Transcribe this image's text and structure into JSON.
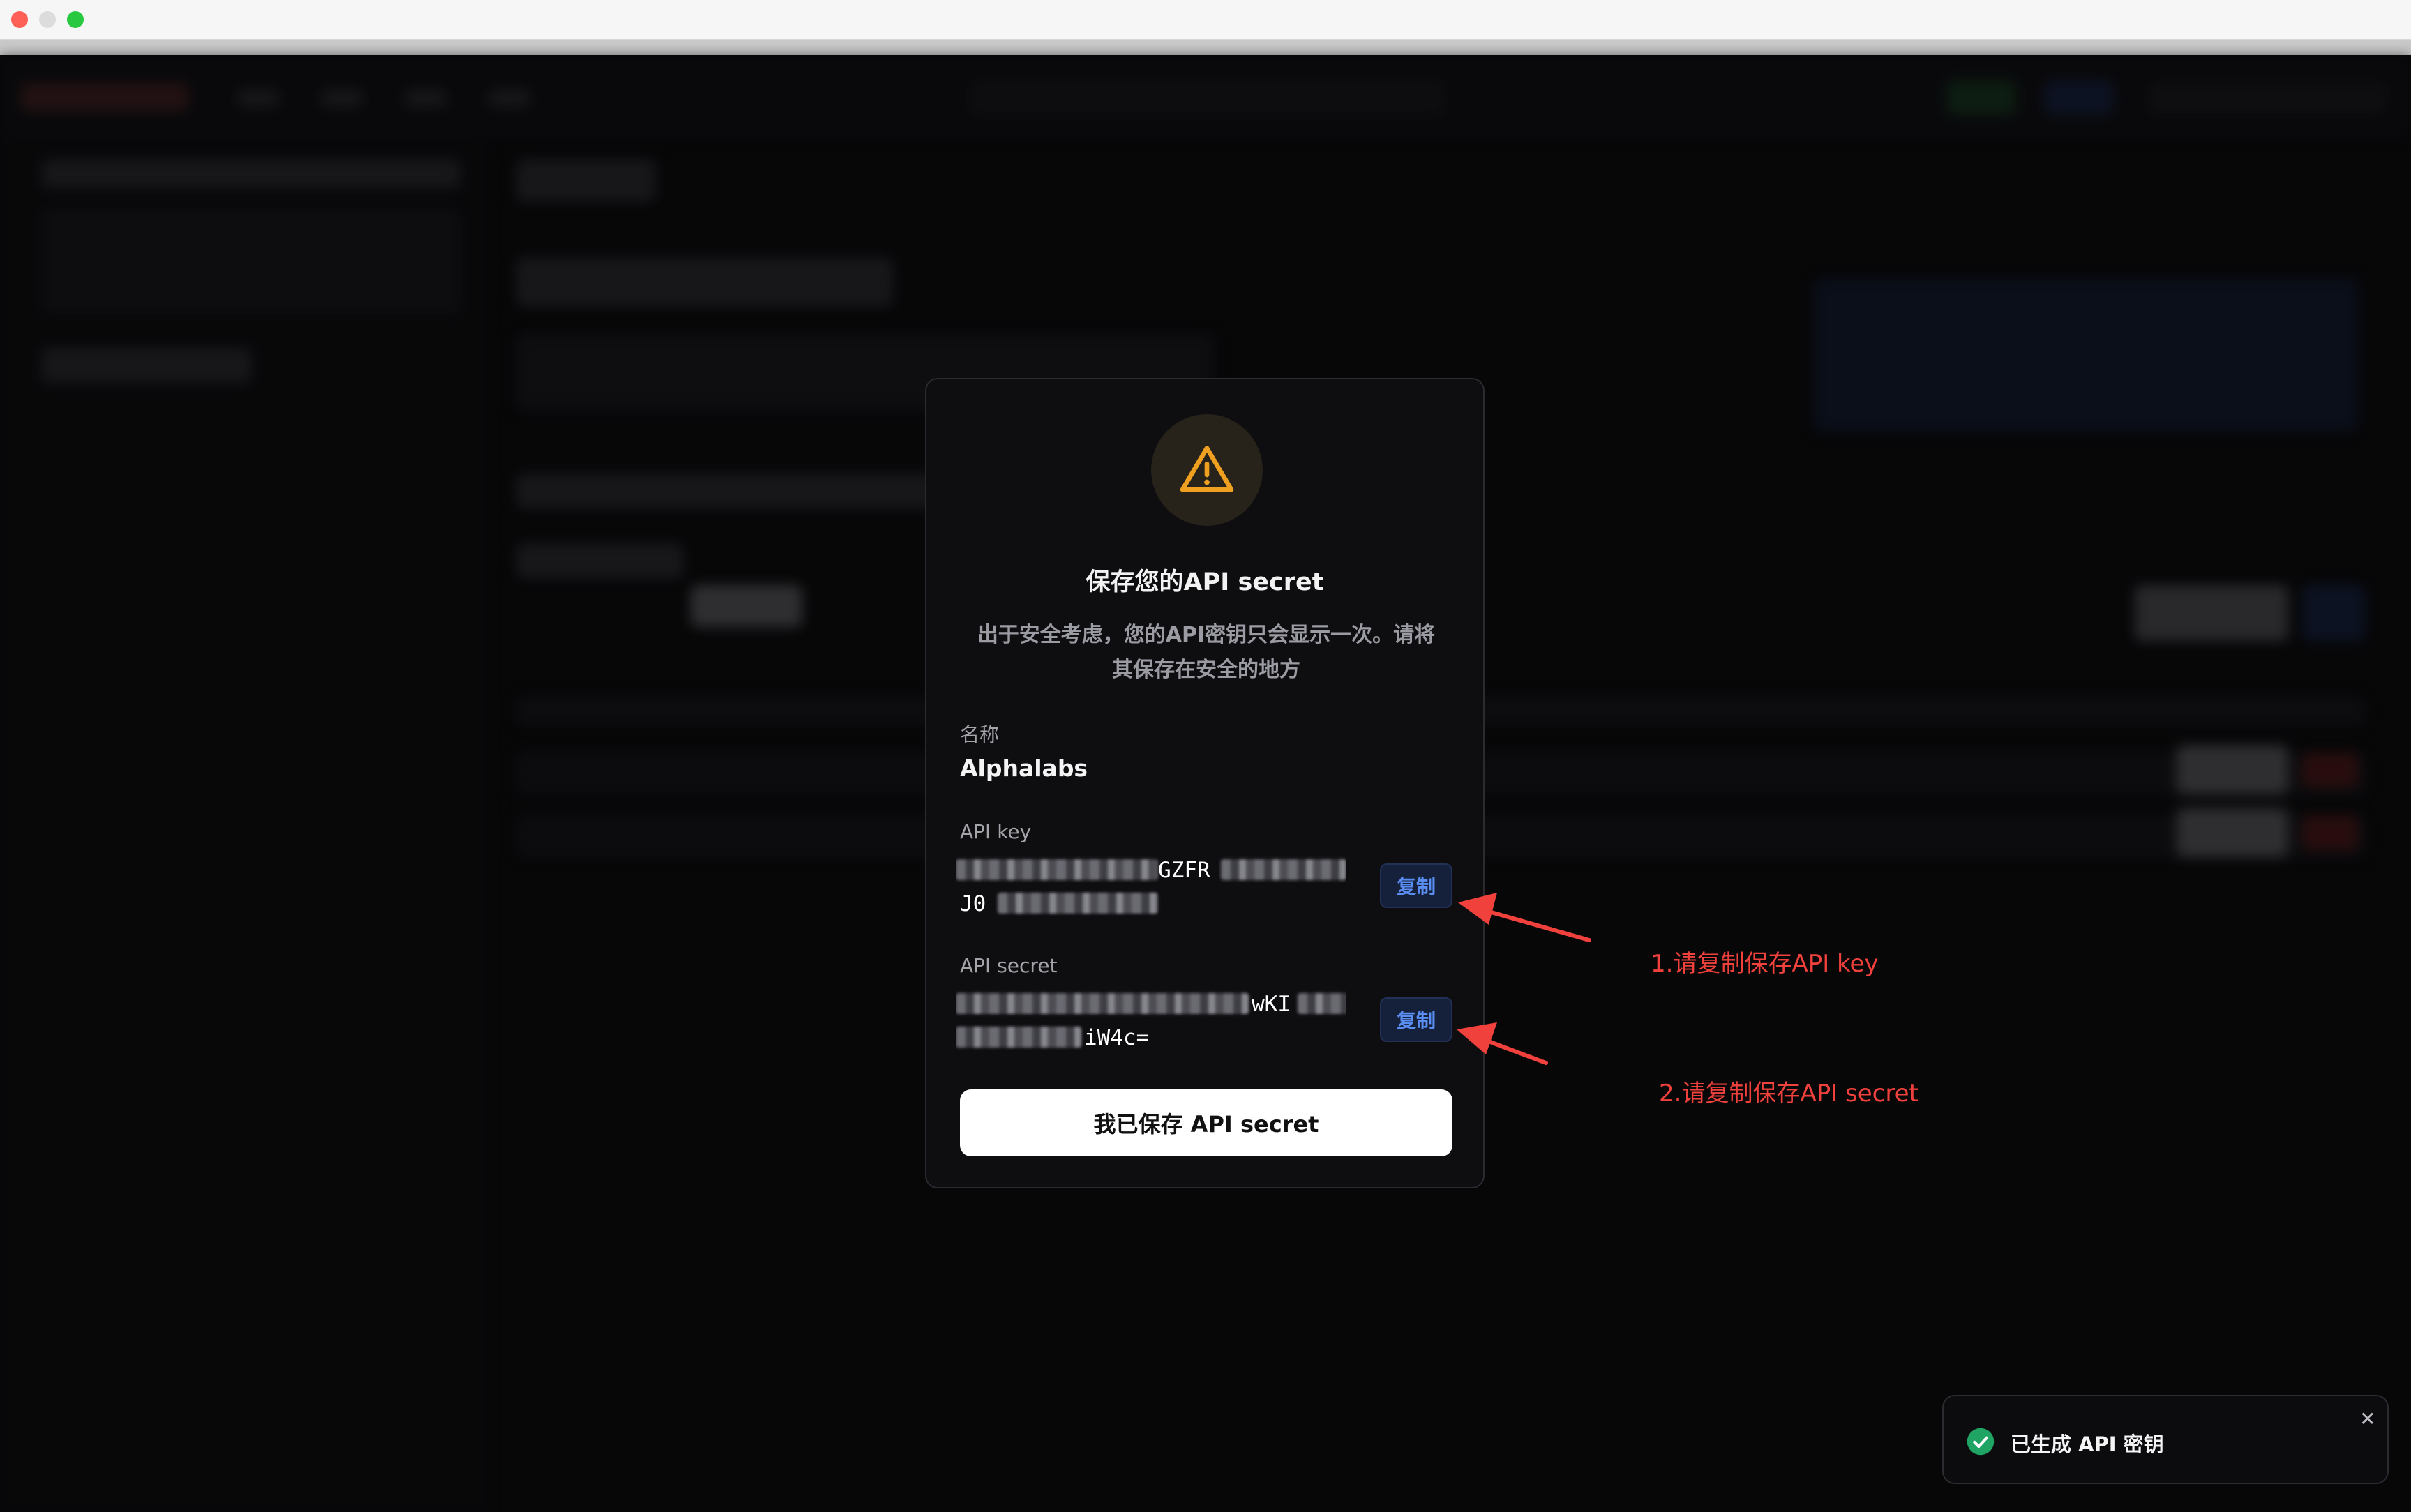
{
  "window": {
    "title_bar": ""
  },
  "modal": {
    "icon": "warning-triangle-icon",
    "title": "保存您的API secret",
    "description_line1": "出于安全考虑，您的API密钥只会显示一次。请将",
    "description_line2": "其保存在安全的地方",
    "name_label": "名称",
    "name_value": "Alphalabs",
    "api_key_label": "API key",
    "api_key_line1_visible": "GZFR",
    "api_key_line2_visible": "J0",
    "api_secret_label": "API secret",
    "api_secret_line1_visible": "wKI",
    "api_secret_line2_visible": "iW4c=",
    "copy_label": "复制",
    "confirm_button": "我已保存 API secret"
  },
  "annotations": {
    "step1": "1.请复制保存API key",
    "step2": "2.请复制保存API secret",
    "color": "#f0413c"
  },
  "toast": {
    "icon": "check-circle-icon",
    "message": "已生成 API 密钥",
    "close_icon": "close-icon"
  },
  "colors": {
    "accent_blue": "#5b8ef2",
    "warning": "#f0a020",
    "success": "#1fa463"
  }
}
